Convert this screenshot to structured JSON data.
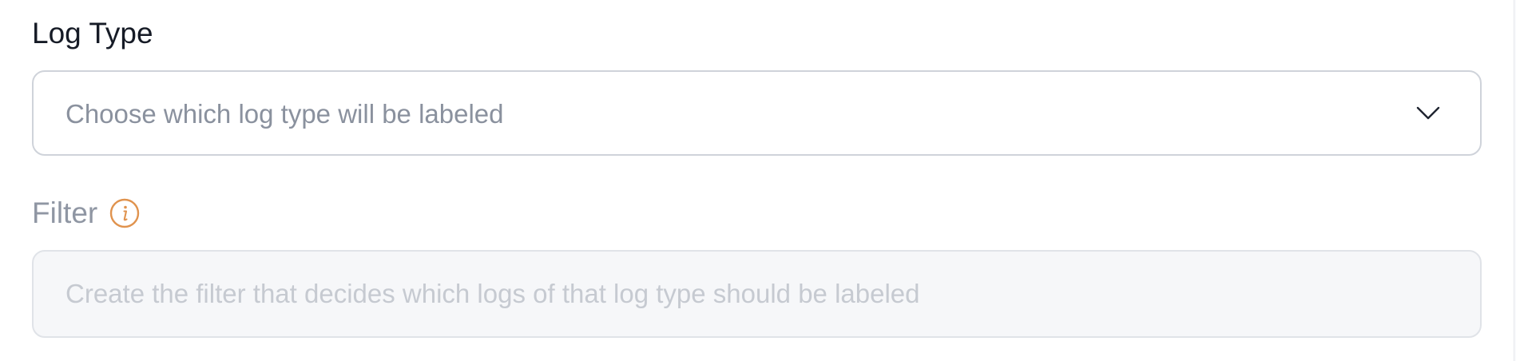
{
  "log_type": {
    "label": "Log Type",
    "select_placeholder": "Choose which log type will be labeled",
    "chevron_icon": "chevron-down-icon"
  },
  "filter": {
    "label": "Filter",
    "info_icon": "info-icon",
    "info_icon_color": "#e0934e",
    "input_value": "",
    "input_placeholder": "Create the filter that decides which logs of that log type should be labeled",
    "disabled": true
  }
}
